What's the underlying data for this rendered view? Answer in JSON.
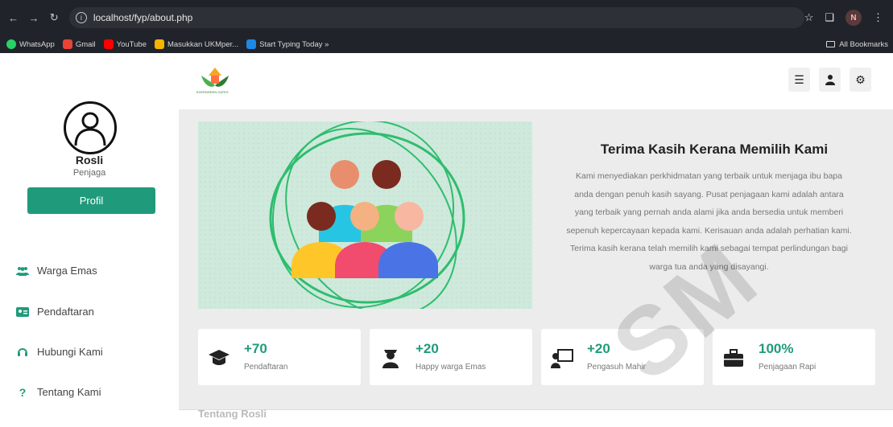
{
  "browser": {
    "url": "localhost/fyp/about.php",
    "profile_initial": "N",
    "bookmarks": [
      {
        "label": "WhatsApp",
        "color": "#25d366"
      },
      {
        "label": "Gmail",
        "color": "#ea4335"
      },
      {
        "label": "YouTube",
        "color": "#ff0000"
      },
      {
        "label": "Masukkan UKMper...",
        "color": "#f5b400"
      },
      {
        "label": "Start Typing Today »",
        "color": "#1e88e5"
      }
    ],
    "all_bookmarks": "All Bookmarks"
  },
  "sidebar": {
    "user_name": "Rosli",
    "user_role": "Penjaga",
    "profile_button": "Profil",
    "items": [
      {
        "label": "Warga Emas",
        "icon": "users-icon"
      },
      {
        "label": "Pendaftaran",
        "icon": "id-card-icon"
      },
      {
        "label": "Hubungi Kami",
        "icon": "headset-icon"
      },
      {
        "label": "Tentang Kami",
        "icon": "question-icon"
      }
    ]
  },
  "header": {
    "logo_text": "EVERGREEN GATES",
    "icons": [
      "menu-icon",
      "user-icon",
      "settings-icon"
    ]
  },
  "hero": {
    "title": "Terima Kasih Kerana Memilih Kami",
    "lines": [
      "Kami menyediakan perkhidmatan yang terbaik untuk menjaga ibu bapa",
      "anda dengan penuh kasih sayang. Pusat penjagaan kami adalah antara",
      "yang terbaik yang pernah anda alami jika anda bersedia untuk memberi",
      "sepenuh kepercayaan kepada kami. Kerisauan anda adalah perhatian kami.",
      "Terima kasih kerana telah memilih kami sebagai tempat perlindungan bagi",
      "warga tua anda yang disayangi."
    ]
  },
  "stats": [
    {
      "value": "+70",
      "label": "Pendaftaran",
      "icon": "graduation-cap-icon"
    },
    {
      "value": "+20",
      "label": "Happy warga Emas",
      "icon": "user-graduate-icon"
    },
    {
      "value": "+20",
      "label": "Pengasuh Mahir",
      "icon": "chalkboard-teacher-icon"
    },
    {
      "value": "100%",
      "label": "Penjagaan Rapi",
      "icon": "briefcase-icon"
    }
  ],
  "bottom": {
    "heading": "Tentang Rosli"
  },
  "watermark": "SM",
  "colors": {
    "accent": "#1f9b7b",
    "chrome": "#20242a",
    "main_bg": "#ececec"
  }
}
